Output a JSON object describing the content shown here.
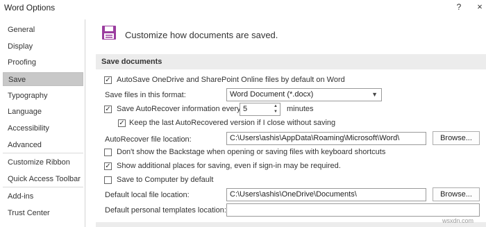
{
  "window": {
    "title": "Word Options",
    "help": "?",
    "close": "×"
  },
  "sidebar": {
    "items": [
      {
        "label": "General"
      },
      {
        "label": "Display"
      },
      {
        "label": "Proofing"
      },
      {
        "label": "Save",
        "active": true
      },
      {
        "label": "Typography"
      },
      {
        "label": "Language"
      },
      {
        "label": "Accessibility"
      },
      {
        "label": "Advanced"
      },
      {
        "label": "Customize Ribbon"
      },
      {
        "label": "Quick Access Toolbar"
      },
      {
        "label": "Add-ins"
      },
      {
        "label": "Trust Center"
      }
    ]
  },
  "main": {
    "header": "Customize how documents are saved.",
    "section_title": "Save documents",
    "autosave_label": "AutoSave OneDrive and SharePoint Online files by default on Word",
    "format_label": "Save files in this format:",
    "format_value": "Word Document (*.docx)",
    "autorecover_label": "Save AutoRecover information every",
    "autorecover_minutes": "5",
    "minutes_label": "minutes",
    "keep_last_label": "Keep the last AutoRecovered version if I close without saving",
    "autorecover_location_label": "AutoRecover file location:",
    "autorecover_location_value": "C:\\Users\\ashis\\AppData\\Roaming\\Microsoft\\Word\\",
    "browse_label": "Browse...",
    "backstage_label": "Don't show the Backstage when opening or saving files with keyboard shortcuts",
    "additional_places_label": "Show additional places for saving, even if sign-in may be required.",
    "save_to_computer_label": "Save to Computer by default",
    "default_local_label": "Default local file location:",
    "default_local_value": "C:\\Users\\ashis\\OneDrive\\Documents\\",
    "browse_label_2": "Browse...",
    "templates_label": "Default personal templates location:",
    "templates_value": ""
  },
  "checkbox_states": {
    "autosave": true,
    "autorecover": true,
    "keep_last": true,
    "backstage": false,
    "additional_places": true,
    "save_to_computer": false
  },
  "checkmark": "✓",
  "watermark": "wsxdn.com",
  "colors": {
    "save_icon": "#9b3d9f",
    "active_nav_bg": "#c8c8c8",
    "section_bg": "#ececec"
  },
  "icons": {
    "save": "floppy-disk-icon",
    "dropdown": "chevron-down-icon",
    "spinner_up": "spin-up-icon",
    "spinner_down": "spin-down-icon",
    "close": "close-icon",
    "help": "help-icon"
  }
}
